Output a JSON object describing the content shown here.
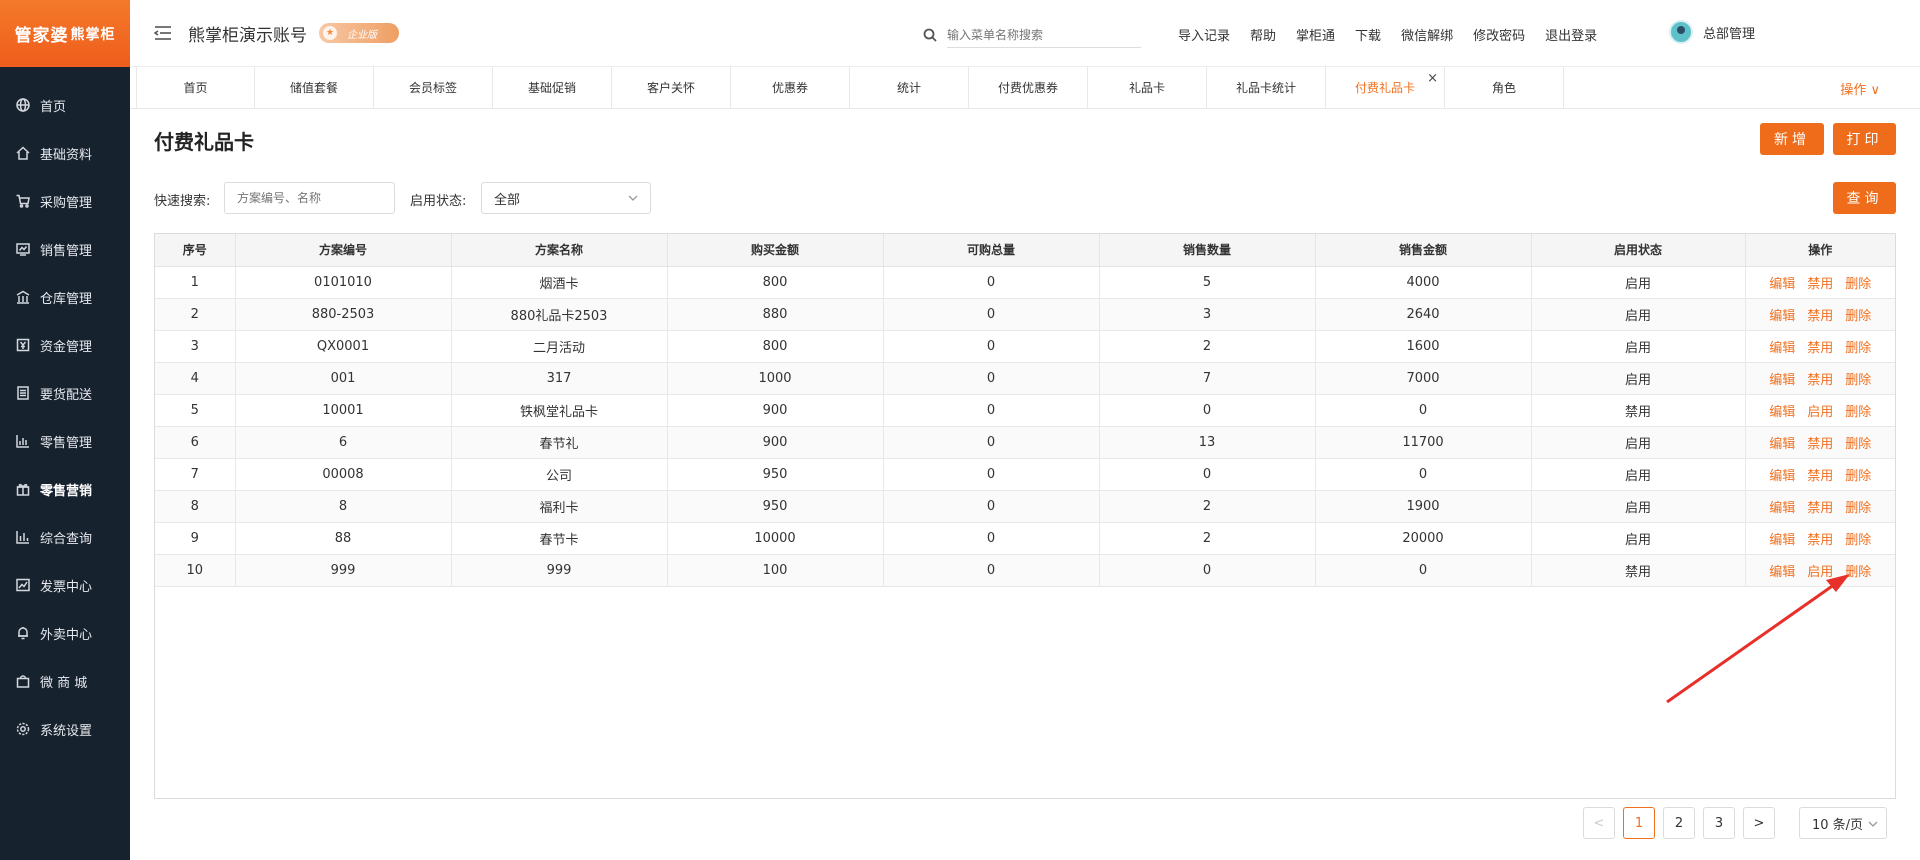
{
  "sidebar": {
    "logo": "管家婆",
    "logo_sub": "熊掌柜",
    "items": [
      {
        "label": "首页",
        "icon": "globe-icon"
      },
      {
        "label": "基础资料",
        "icon": "home-icon"
      },
      {
        "label": "采购管理",
        "icon": "cart-icon"
      },
      {
        "label": "销售管理",
        "icon": "screen-icon"
      },
      {
        "label": "仓库管理",
        "icon": "warehouse-icon"
      },
      {
        "label": "资金管理",
        "icon": "money-icon"
      },
      {
        "label": "要货配送",
        "icon": "list-icon"
      },
      {
        "label": "零售管理",
        "icon": "bar-chart-icon"
      },
      {
        "label": "零售营销",
        "icon": "gift-icon",
        "active": true
      },
      {
        "label": "综合查询",
        "icon": "chart-icon"
      },
      {
        "label": "发票中心",
        "icon": "trend-icon"
      },
      {
        "label": "外卖中心",
        "icon": "bell-icon"
      },
      {
        "label": "微 商 城",
        "icon": "bag-icon"
      },
      {
        "label": "系统设置",
        "icon": "gear-icon"
      }
    ]
  },
  "header": {
    "account_title": "熊掌柜演示账号",
    "edition": "企业版",
    "search_placeholder": "输入菜单名称搜索",
    "links": [
      "导入记录",
      "帮助",
      "掌柜通",
      "下载",
      "微信解绑",
      "修改密码",
      "退出登录"
    ],
    "user": "总部管理"
  },
  "tabs": {
    "items": [
      "首页",
      "储值套餐",
      "会员标签",
      "基础促销",
      "客户关怀",
      "优惠券",
      "统计",
      "付费优惠券",
      "礼品卡",
      "礼品卡统计",
      "付费礼品卡",
      "角色"
    ],
    "active_index": 10,
    "close_glyph": "×",
    "ops": "操作"
  },
  "page": {
    "title": "付费礼品卡",
    "new_button": "新增",
    "print_button": "打印",
    "query_button": "查询"
  },
  "filters": {
    "quick_search_label": "快速搜索:",
    "quick_search_placeholder": "方案编号、名称",
    "status_label": "启用状态:",
    "status_value": "全部"
  },
  "table": {
    "columns": [
      "序号",
      "方案编号",
      "方案名称",
      "购买金额",
      "可购总量",
      "销售数量",
      "销售金额",
      "启用状态",
      "操作"
    ],
    "rows": [
      {
        "no": "1",
        "code": "0101010",
        "name": "烟酒卡",
        "price": "800",
        "total": "0",
        "qty": "5",
        "amount": "4000",
        "status": "启用",
        "toggle": "禁用"
      },
      {
        "no": "2",
        "code": "880-2503",
        "name": "880礼品卡2503",
        "price": "880",
        "total": "0",
        "qty": "3",
        "amount": "2640",
        "status": "启用",
        "toggle": "禁用"
      },
      {
        "no": "3",
        "code": "QX0001",
        "name": "二月活动",
        "price": "800",
        "total": "0",
        "qty": "2",
        "amount": "1600",
        "status": "启用",
        "toggle": "禁用"
      },
      {
        "no": "4",
        "code": "001",
        "name": "317",
        "price": "1000",
        "total": "0",
        "qty": "7",
        "amount": "7000",
        "status": "启用",
        "toggle": "禁用"
      },
      {
        "no": "5",
        "code": "10001",
        "name": "铁枫堂礼品卡",
        "price": "900",
        "total": "0",
        "qty": "0",
        "amount": "0",
        "status": "禁用",
        "toggle": "启用"
      },
      {
        "no": "6",
        "code": "6",
        "name": "春节礼",
        "price": "900",
        "total": "0",
        "qty": "13",
        "amount": "11700",
        "status": "启用",
        "toggle": "禁用"
      },
      {
        "no": "7",
        "code": "00008",
        "name": "公司",
        "price": "950",
        "total": "0",
        "qty": "0",
        "amount": "0",
        "status": "启用",
        "toggle": "禁用"
      },
      {
        "no": "8",
        "code": "8",
        "name": "福利卡",
        "price": "950",
        "total": "0",
        "qty": "2",
        "amount": "1900",
        "status": "启用",
        "toggle": "禁用"
      },
      {
        "no": "9",
        "code": "88",
        "name": "春节卡",
        "price": "10000",
        "total": "0",
        "qty": "2",
        "amount": "20000",
        "status": "启用",
        "toggle": "禁用"
      },
      {
        "no": "10",
        "code": "999",
        "name": "999",
        "price": "100",
        "total": "0",
        "qty": "0",
        "amount": "0",
        "status": "禁用",
        "toggle": "启用"
      }
    ],
    "edit_label": "编辑",
    "delete_label": "删除"
  },
  "pagination": {
    "prev": "<",
    "next": ">",
    "pages": [
      "1",
      "2",
      "3"
    ],
    "current": "1",
    "page_size": "10 条/页"
  },
  "colors": {
    "accent": "#ef6c1a",
    "sidebar_bg": "#17222f",
    "annotation_arrow": "#e8302a"
  }
}
